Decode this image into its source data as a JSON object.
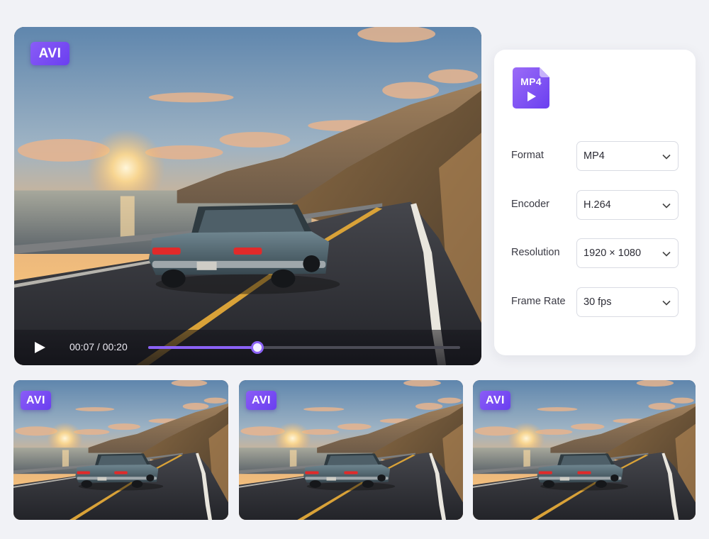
{
  "player": {
    "format_badge": "AVI",
    "time_display": "00:07 / 00:20",
    "progress": 0.35,
    "play_icon": "play-icon"
  },
  "settings": {
    "output_icon_label": "MP4",
    "output_icon": "video-file-icon",
    "rows": [
      {
        "label": "Format",
        "value": "MP4"
      },
      {
        "label": "Encoder",
        "value": "H.264"
      },
      {
        "label": "Resolution",
        "value": "1920 × 1080"
      },
      {
        "label": "Frame Rate",
        "value": "30 fps"
      }
    ]
  },
  "thumbnails": [
    {
      "badge": "AVI"
    },
    {
      "badge": "AVI"
    },
    {
      "badge": "AVI"
    }
  ],
  "colors": {
    "accent": "#8b62f5",
    "badge": "#7a4cf3",
    "panel_bg": "#ffffff",
    "page_bg": "#f1f2f6"
  }
}
